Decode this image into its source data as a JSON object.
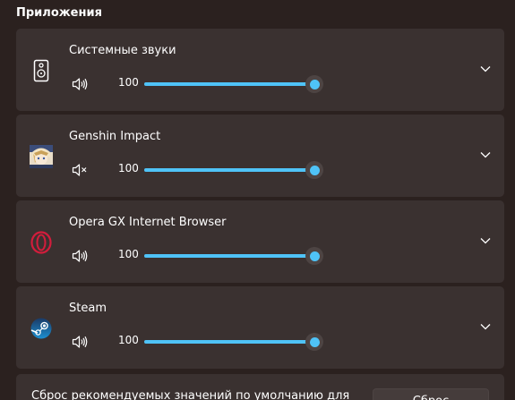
{
  "section": {
    "title": "Приложения"
  },
  "apps": [
    {
      "name": "Системные звуки",
      "volume": "100",
      "level": 1.0,
      "muted": false,
      "icon": "speaker-device-icon"
    },
    {
      "name": "Genshin Impact",
      "volume": "100",
      "level": 1.0,
      "muted": true,
      "icon": "genshin-impact-icon"
    },
    {
      "name": "Opera GX Internet Browser",
      "volume": "100",
      "level": 1.0,
      "muted": false,
      "icon": "opera-gx-icon"
    },
    {
      "name": "Steam",
      "volume": "100",
      "level": 1.0,
      "muted": false,
      "icon": "steam-icon"
    }
  ],
  "reset": {
    "text": "Сброс рекомендуемых значений по умолчанию для",
    "button_label": "Сброс"
  },
  "colors": {
    "accent": "#4fc3f7",
    "card": "#3a3130",
    "background": "#2b211f",
    "opera": "#d21d3c"
  }
}
